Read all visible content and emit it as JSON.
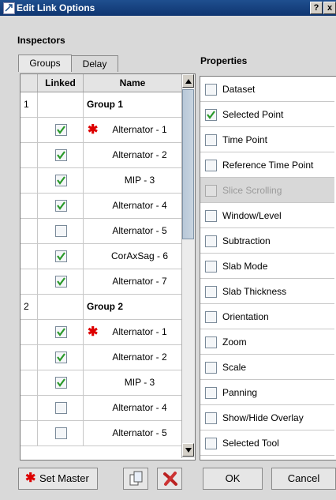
{
  "window": {
    "title": "Edit Link Options",
    "help": "?",
    "close": "x"
  },
  "inspectors_heading": "Inspectors",
  "properties_heading": "Properties",
  "tabs": [
    "Groups",
    "Delay"
  ],
  "grid": {
    "headers": [
      "",
      "Linked",
      "Name"
    ],
    "rows": [
      {
        "type": "group",
        "index": "1",
        "name": "Group 1"
      },
      {
        "type": "item",
        "checked": true,
        "master": true,
        "name": "Alternator - 1"
      },
      {
        "type": "item",
        "checked": true,
        "master": false,
        "name": "Alternator - 2"
      },
      {
        "type": "item",
        "checked": true,
        "master": false,
        "name": "MIP - 3"
      },
      {
        "type": "item",
        "checked": true,
        "master": false,
        "name": "Alternator - 4"
      },
      {
        "type": "item",
        "checked": false,
        "master": false,
        "name": "Alternator - 5"
      },
      {
        "type": "item",
        "checked": true,
        "master": false,
        "name": "CorAxSag - 6"
      },
      {
        "type": "item",
        "checked": true,
        "master": false,
        "name": "Alternator - 7"
      },
      {
        "type": "group",
        "index": "2",
        "name": "Group 2"
      },
      {
        "type": "item",
        "checked": true,
        "master": true,
        "name": "Alternator - 1"
      },
      {
        "type": "item",
        "checked": true,
        "master": false,
        "name": "Alternator - 2"
      },
      {
        "type": "item",
        "checked": true,
        "master": false,
        "name": "MIP - 3"
      },
      {
        "type": "item",
        "checked": false,
        "master": false,
        "name": "Alternator - 4"
      },
      {
        "type": "item",
        "checked": false,
        "master": false,
        "name": "Alternator - 5"
      }
    ]
  },
  "properties": [
    {
      "label": "Dataset",
      "checked": false,
      "disabled": false
    },
    {
      "label": "Selected Point",
      "checked": true,
      "disabled": false
    },
    {
      "label": "Time Point",
      "checked": false,
      "disabled": false
    },
    {
      "label": "Reference Time Point",
      "checked": false,
      "disabled": false
    },
    {
      "label": "Slice Scrolling",
      "checked": false,
      "disabled": true
    },
    {
      "label": "Window/Level",
      "checked": false,
      "disabled": false
    },
    {
      "label": "Subtraction",
      "checked": false,
      "disabled": false
    },
    {
      "label": "Slab Mode",
      "checked": false,
      "disabled": false
    },
    {
      "label": "Slab Thickness",
      "checked": false,
      "disabled": false
    },
    {
      "label": "Orientation",
      "checked": false,
      "disabled": false
    },
    {
      "label": "Zoom",
      "checked": false,
      "disabled": false
    },
    {
      "label": "Scale",
      "checked": false,
      "disabled": false
    },
    {
      "label": "Panning",
      "checked": false,
      "disabled": false
    },
    {
      "label": "Show/Hide Overlay",
      "checked": false,
      "disabled": false
    },
    {
      "label": "Selected Tool",
      "checked": false,
      "disabled": false
    }
  ],
  "buttons": {
    "set_master": "Set Master",
    "ok": "OK",
    "cancel": "Cancel"
  },
  "icons": {
    "star": "✱",
    "copy": "copy-icon",
    "delete": "delete-x-icon"
  },
  "colors": {
    "titlebar": "#1f4f8f",
    "check": "#2a9a2a",
    "star": "#dd0000"
  }
}
